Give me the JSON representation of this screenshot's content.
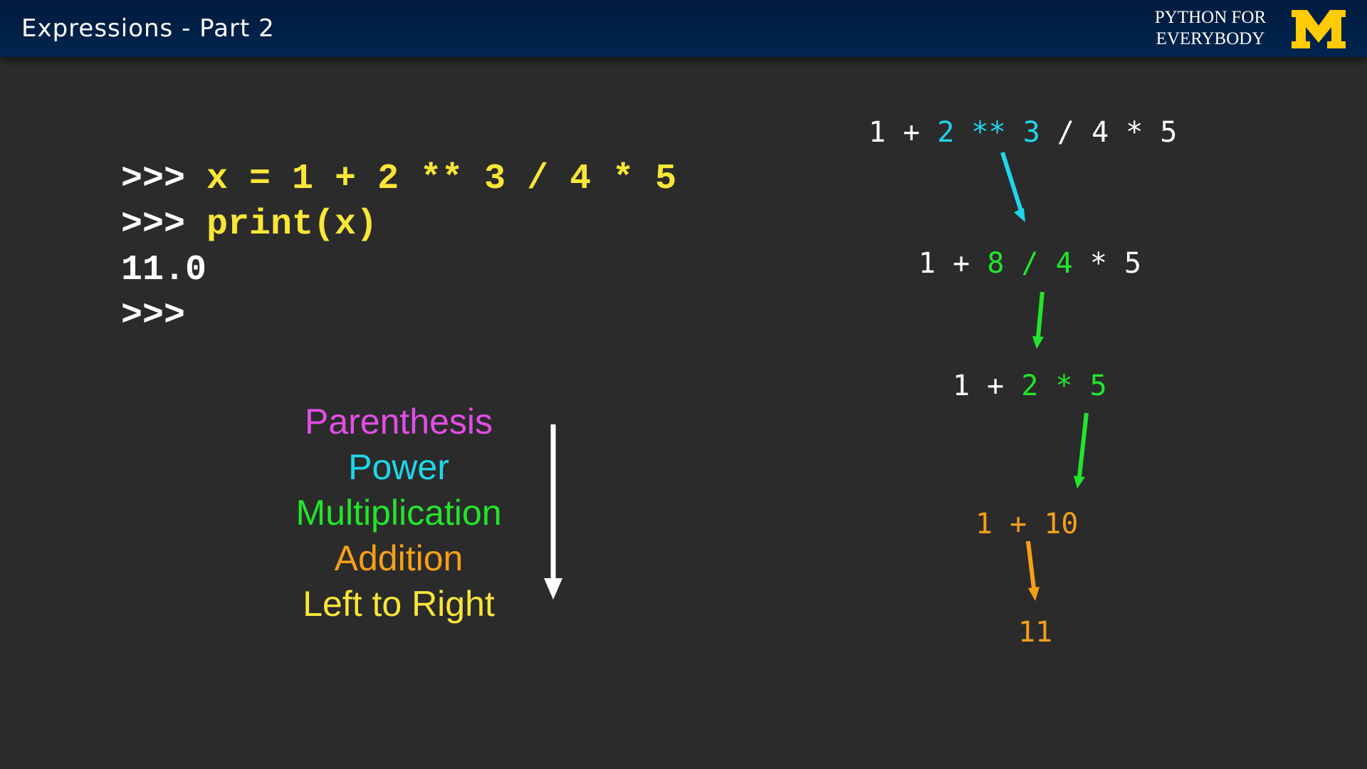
{
  "header": {
    "title": "Expressions - Part 2",
    "brand_line1": "PYTHON FOR",
    "brand_line2": "EVERYBODY",
    "logo_letter": "M"
  },
  "colors": {
    "white": "#ffffff",
    "yellow": "#f9e637",
    "magenta": "#e24de6",
    "cyan": "#1fd6ea",
    "green": "#22e52b",
    "orange": "#f5a019",
    "maize": "#ffcb05",
    "navy": "#00274c"
  },
  "repl": {
    "prompt": ">>>",
    "line1_code": "x = 1 + 2 ** 3 / 4 * 5",
    "line2_code": "print(x)",
    "output": "11.0"
  },
  "precedence": {
    "items": [
      {
        "label": "Parenthesis",
        "color": "#e24de6"
      },
      {
        "label": "Power",
        "color": "#1fd6ea"
      },
      {
        "label": "Multiplication",
        "color": "#22e52b"
      },
      {
        "label": "Addition",
        "color": "#f5a019"
      },
      {
        "label": "Left to Right",
        "color": "#f9e637"
      }
    ],
    "arrow_icon": "down-arrow-icon"
  },
  "steps": [
    {
      "parts": [
        {
          "text": "1 + ",
          "color": "#ffffff"
        },
        {
          "text": "2 ** 3",
          "color": "#1fd6ea"
        },
        {
          "text": " / 4 * 5",
          "color": "#ffffff"
        }
      ]
    },
    {
      "parts": [
        {
          "text": "1 + ",
          "color": "#ffffff"
        },
        {
          "text": "8 / 4",
          "color": "#22e52b"
        },
        {
          "text": " * 5",
          "color": "#ffffff"
        }
      ]
    },
    {
      "parts": [
        {
          "text": "1 + ",
          "color": "#ffffff"
        },
        {
          "text": "2 * 5",
          "color": "#22e52b"
        }
      ]
    },
    {
      "parts": [
        {
          "text": "1 + 10",
          "color": "#f5a019"
        }
      ]
    },
    {
      "parts": [
        {
          "text": "11",
          "color": "#f5a019"
        }
      ]
    }
  ]
}
